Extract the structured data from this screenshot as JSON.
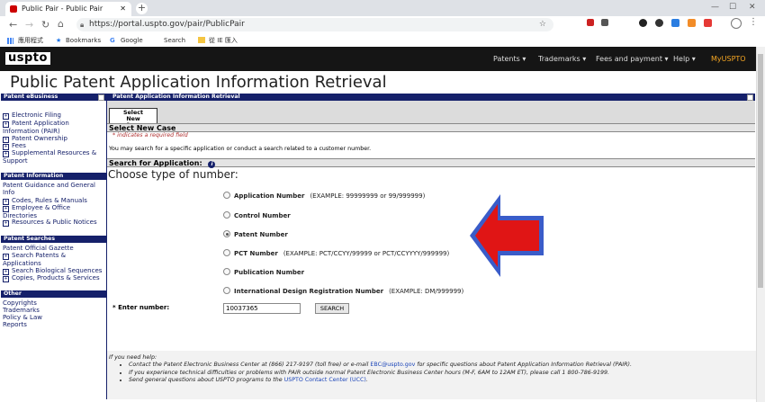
{
  "browser": {
    "tabs": [
      {
        "title": "Public Pair - Public Pair",
        "active": true
      },
      {
        "title": "",
        "active": false
      },
      {
        "title": "",
        "active": false
      },
      {
        "title": "",
        "active": false
      }
    ],
    "url": "https://portal.uspto.gov/pair/PublicPair",
    "bookmarks": [
      "應用程式",
      "Bookmarks",
      "Google",
      "Search",
      "從 IE 匯入"
    ]
  },
  "header": {
    "logo": "uspto",
    "nav": [
      "Patents ▾",
      "Trademarks ▾",
      "Fees and payment ▾",
      "Help ▾",
      "MyUSPTO"
    ],
    "myuspto_color": "#f5a623",
    "title": "Public Patent Application Information Retrieval"
  },
  "sidebar": {
    "sections": [
      {
        "title": "Patent eBusiness",
        "items": [
          "Electronic Filing",
          "Patent Application Information (PAIR)",
          "Patent Ownership",
          "Fees",
          "Supplemental Resources & Support"
        ]
      },
      {
        "title": "Patent Information",
        "items": [
          "Patent Guidance and General Info",
          "Codes, Rules & Manuals",
          "Employee & Office Directories",
          "Resources & Public Notices"
        ]
      },
      {
        "title": "Patent Searches",
        "items": [
          "Patent Official Gazette",
          "Search Patents & Applications",
          "Search Biological Sequences",
          "Copies, Products & Services"
        ]
      },
      {
        "title": "Other",
        "items": [
          "Copyrights",
          "Trademarks",
          "Policy & Law",
          "Reports"
        ]
      }
    ]
  },
  "main": {
    "panel_title": "Patent Application Information Retrieval",
    "tab_label": "Select New Case",
    "section_title": "Select New Case",
    "required_note": "* indicates a required field",
    "description": "You may search for a specific application or conduct a search related to a customer number.",
    "search_for": "Search for Application:",
    "choose_type": "Choose type of number:",
    "options": [
      {
        "label": "Application Number",
        "example": "(EXAMPLE: 99999999 or 99/999999)",
        "selected": false
      },
      {
        "label": "Control Number",
        "example": "",
        "selected": false
      },
      {
        "label": "Patent Number",
        "example": "",
        "selected": true
      },
      {
        "label": "PCT Number",
        "example": "(EXAMPLE: PCT/CCYY/99999 or PCT/CCYYYY/999999)",
        "selected": false
      },
      {
        "label": "Publication Number",
        "example": "",
        "selected": false
      },
      {
        "label": "International Design Registration Number",
        "example": "(EXAMPLE: DM/999999)",
        "selected": false
      }
    ],
    "enter_number_label": "* Enter number:",
    "enter_number_value": "10037365",
    "search_button": "SEARCH",
    "arrow_color": "#e01515",
    "arrow_outline": "#3a5cc9"
  },
  "footer": {
    "intro": "If you need help:",
    "items": [
      {
        "pre": "Contact the Patent Electronic Business Center at (866) 217-9197 (toll free) or e-mail ",
        "link": "EBC@uspto.gov",
        "post": " for specific questions about Patent Application Information Retrieval (PAIR)."
      },
      {
        "pre": "If you experience technical difficulties or problems with PAIR outside normal Patent Electronic Business Center hours (M-F, 6AM to 12AM ET), please call 1 800-786-9199.",
        "link": "",
        "post": ""
      },
      {
        "pre": "Send general questions about USPTO programs to the ",
        "link": "USPTO Contact Center (UCC)",
        "post": "."
      }
    ]
  }
}
